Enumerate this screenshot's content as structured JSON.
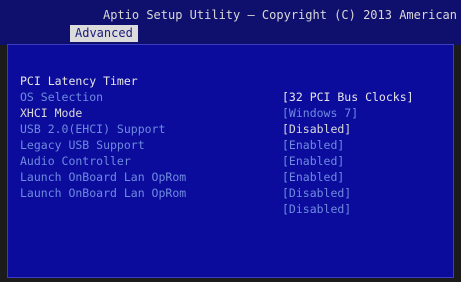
{
  "header": {
    "title": "Aptio Setup Utility – Copyright (C) 2013 American",
    "tab": "Advanced"
  },
  "settings": [
    {
      "label": "PCI Latency Timer",
      "value": "[32 PCI Bus Clocks]"
    },
    {
      "label": "OS Selection",
      "value": "[Windows 7]"
    },
    {
      "label": "XHCI Mode",
      "value": "[Disabled]"
    },
    {
      "label": "USB 2.0(EHCI) Support",
      "value": "[Enabled]"
    },
    {
      "label": "Legacy USB Support",
      "value": "[Enabled]"
    },
    {
      "label": "Audio Controller",
      "value": "[Enabled]"
    },
    {
      "label": "Launch OnBoard Lan OpRom",
      "value": "[Disabled]"
    },
    {
      "label": "Launch OnBoard Lan OpRom",
      "value": "[Disabled]"
    }
  ],
  "colors": {
    "header_bg": "#0f0f6e",
    "panel_bg": "#0c0c9c",
    "tab_bg": "#dcdcdc",
    "selectable_text": "#6f8ae0",
    "static_text": "#dadada"
  }
}
